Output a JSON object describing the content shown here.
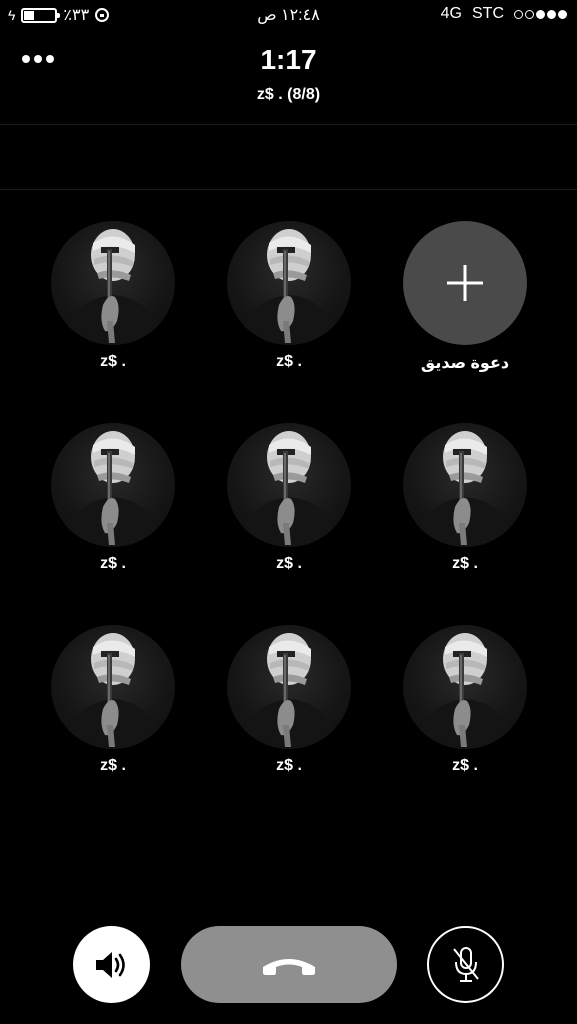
{
  "status_bar": {
    "battery_percent": "٪٣٣",
    "battery_level": 0.33,
    "time": "١٢:٤٨ ص",
    "network": "4G",
    "carrier": "STC",
    "signal_strength": 3,
    "signal_max": 5
  },
  "header": {
    "call_duration": "1:17",
    "call_subtitle": "z$ . (8/8)"
  },
  "participants": [
    {
      "name": "z$ ."
    },
    {
      "name": "z$ ."
    },
    {
      "name": "z$ ."
    },
    {
      "name": "z$ ."
    },
    {
      "name": "z$ ."
    },
    {
      "name": "z$ ."
    },
    {
      "name": "z$ ."
    },
    {
      "name": "z$ ."
    }
  ],
  "invite": {
    "label": "دعوة صديق"
  },
  "controls": {
    "speaker_icon": "speaker-icon",
    "end_call_icon": "phone-hangup-icon",
    "mute_icon": "mic-muted-icon"
  },
  "colors": {
    "background": "#000000",
    "invite_circle": "#4a4a4a",
    "end_call": "#8f8f8f"
  }
}
